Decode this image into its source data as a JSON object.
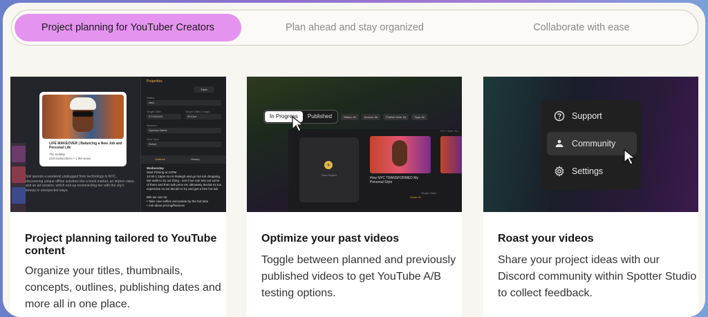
{
  "tabs": [
    {
      "label": "Project planning for YouTuber Creators",
      "active": true
    },
    {
      "label": "Plan ahead and stay organized",
      "active": false
    },
    {
      "label": "Collaborate with ease",
      "active": false
    }
  ],
  "cards": [
    {
      "title": "Project planning tailored to YouTube content",
      "body": "Organize your titles, thumbnails, concepts, outlines, publishing dates and more all in one place.",
      "shot": {
        "video_title": "LIFE MAKEOVER | Balancing a New Job and Personal Life",
        "channel": "The DeMity",
        "channel_meta": "21M Subscribers • 1.9M views",
        "description": "Soli spends a weekend unplugged from technology in NYC, discovering unique offline activities like a book market, an improv class, and an art session, which end up reconnecting her with the city's beauty in unexpected ways.",
        "properties_title": "Properties",
        "tag": "Topic",
        "fields": [
          {
            "label": "Status",
            "value": "Idea"
          },
          {
            "label": "Single Date",
            "value": "07/15/2024"
          },
          {
            "label": "Target Video Length",
            "value": "00:10m"
          },
          {
            "label": "Sponsor",
            "value": "Sponsor Name"
          },
          {
            "label": "Shirt Type",
            "value": "Select"
          }
        ],
        "tab_a": "Outlined",
        "tab_b": "History",
        "notes_heading": "Wednesday",
        "notes": "Start Filming at 12PM\n12:30 1:15pm Go to Raleigh and go hot tub shopping. We walk to do our thing - see if we can test out some of them and then talk price etc ultimately decide its too expensive so we decide to try and get a free hot tub.\n\nBits we can do:\n• Take cute selfies and praise by the hot tubs\n• Ask about pricing/finances"
      }
    },
    {
      "title": "Optimize your past videos",
      "body": "Toggle between planned and previously published videos to get YouTube A/B testing options.",
      "shot": {
        "toggle_a": "In Progress",
        "toggle_b": "Published",
        "filters": [
          "Status: All",
          "Access: All",
          "Publish Date: All",
          "Tags: All"
        ],
        "new_project": "New Project",
        "video_title": "How NYC TRANSFORMED My Personal Style",
        "right_label": "NYC Style Vid...",
        "meta_label": "Single Video",
        "meta_value": "Score 91"
      }
    },
    {
      "title": "Roast your videos",
      "body": "Share your project ideas with our Discord community within Spotter Studio to collect feedback.",
      "shot": {
        "menu": [
          {
            "label": "Support",
            "icon": "question-icon"
          },
          {
            "label": "Community",
            "icon": "community-icon",
            "highlighted": true
          },
          {
            "label": "Settings",
            "icon": "gear-icon"
          }
        ]
      }
    }
  ],
  "colors": {
    "accent_tab": "#e493ef",
    "panel": "#f8f6f1"
  }
}
